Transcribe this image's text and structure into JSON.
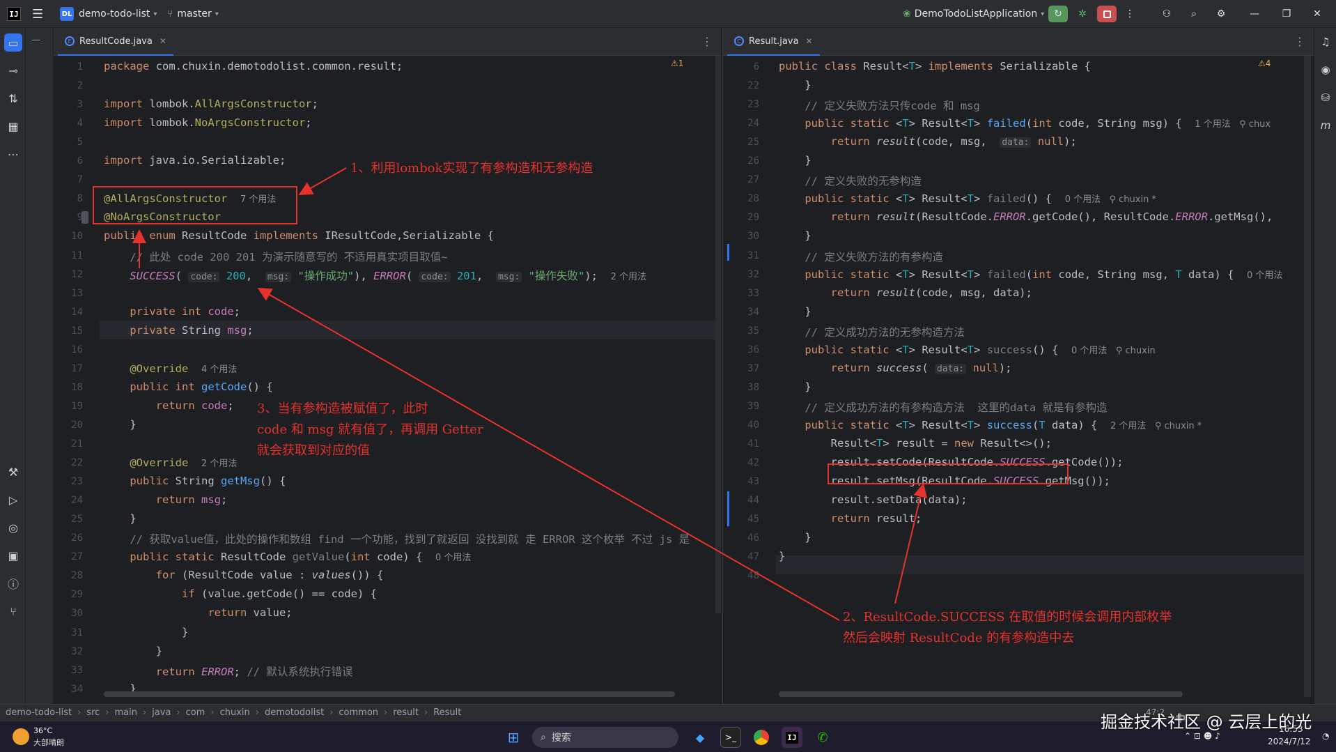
{
  "titlebar": {
    "app_logo": "IJ",
    "project_badge": "DL",
    "project_name": "demo-todo-list",
    "branch": "master",
    "run_config": "DemoTodoListApplication"
  },
  "left_editor": {
    "tab": "ResultCode.java",
    "warnings": "⚠1",
    "lines": [
      {
        "n": "1",
        "html": "<span class='kw'>package</span> com.chuxin.demotodolist.common.result;"
      },
      {
        "n": "2",
        "html": ""
      },
      {
        "n": "3",
        "html": "<span class='kw'>import</span> lombok.<span class='ann'>AllArgsConstructor</span>;"
      },
      {
        "n": "4",
        "html": "<span class='kw'>import</span> lombok.<span class='ann'>NoArgsConstructor</span>;"
      },
      {
        "n": "5",
        "html": ""
      },
      {
        "n": "6",
        "html": "<span class='kw'>import</span> java.io.Serializable;"
      },
      {
        "n": "7",
        "html": ""
      },
      {
        "n": "8",
        "html": "<span class='ann'>@AllArgsConstructor</span>  <span class='hint'>7 个用法</span>"
      },
      {
        "n": "9",
        "html": "<span class='ann'>@NoArgsConstructor</span>"
      },
      {
        "n": "10",
        "html": "<span class='kw'>public enum</span> ResultCode <span class='kw'>implements</span> IResultCode,Serializable {"
      },
      {
        "n": "11",
        "html": "    <span class='cm'>// 此处 code 200 201 为演示随意写的 不适用真实项目取值~</span>"
      },
      {
        "n": "12",
        "html": "    <span class='cst'>SUCCESS</span>( <span class='inlay'>code:</span> <span class='num'>200</span>,  <span class='inlay'>msg:</span> <span class='str'>\"操作成功\"</span>), <span class='cst'>ERROR</span>( <span class='inlay'>code:</span> <span class='num'>201</span>,  <span class='inlay'>msg:</span> <span class='str'>\"操作失败\"</span>);  <span class='hint'>2 个用法</span>"
      },
      {
        "n": "13",
        "html": ""
      },
      {
        "n": "14",
        "html": "    <span class='kw'>private int</span> <span class='cst' style='font-style:normal'>code</span>;"
      },
      {
        "n": "15",
        "html": "    <span class='kw'>private</span> String <span class='cst' style='font-style:normal'>msg</span>;"
      },
      {
        "n": "16",
        "html": ""
      },
      {
        "n": "17",
        "html": "    <span class='ann'>@Override</span>  <span class='hint'>4 个用法</span>"
      },
      {
        "n": "18",
        "html": "    <span class='kw'>public int</span> <span class='fn'>getCode</span>() {"
      },
      {
        "n": "19",
        "html": "        <span class='kw'>return</span> <span class='cst' style='font-style:normal'>code</span>;"
      },
      {
        "n": "20",
        "html": "    }"
      },
      {
        "n": "21",
        "html": ""
      },
      {
        "n": "22",
        "html": "    <span class='ann'>@Override</span>  <span class='hint'>2 个用法</span>"
      },
      {
        "n": "23",
        "html": "    <span class='kw'>public</span> String <span class='fn'>getMsg</span>() {"
      },
      {
        "n": "24",
        "html": "        <span class='kw'>return</span> <span class='cst' style='font-style:normal'>msg</span>;"
      },
      {
        "n": "25",
        "html": "    }"
      },
      {
        "n": "26",
        "html": "    <span class='cm'>// 获取value值，此处的操作和数组 find 一个功能，找到了就返回 没找到就 走 ERROR 这个枚举 不过 js 是</span>"
      },
      {
        "n": "27",
        "html": "    <span class='kw'>public static</span> ResultCode <span class='fn' style='color:#7a7e85'>getValue</span>(<span class='kw'>int</span> code) {  <span class='hint'>0 个用法</span>"
      },
      {
        "n": "28",
        "html": "        <span class='kw'>for</span> (ResultCode value : <span class='it'>values</span>()) {"
      },
      {
        "n": "29",
        "html": "            <span class='kw'>if</span> (value.getCode() == code) {"
      },
      {
        "n": "30",
        "html": "                <span class='kw'>return</span> value;"
      },
      {
        "n": "31",
        "html": "            }"
      },
      {
        "n": "32",
        "html": "        }"
      },
      {
        "n": "33",
        "html": "        <span class='kw'>return</span> <span class='cst'>ERROR</span>; <span class='cm'>// 默认系统执行错误</span>"
      },
      {
        "n": "34",
        "html": "    }"
      }
    ]
  },
  "right_editor": {
    "tab": "Result.java",
    "warnings": "⚠4",
    "lines": [
      {
        "n": "6",
        "html": "<span class='kw'>public class</span> Result&lt;<span class='num'>T</span>&gt; <span class='kw'>implements</span> Serializable {"
      },
      {
        "n": "22",
        "html": "    }"
      },
      {
        "n": "23",
        "html": "    <span class='cm'>// 定义失败方法只传code 和 msg</span>"
      },
      {
        "n": "24",
        "html": "    <span class='kw'>public static</span> &lt;<span class='num'>T</span>&gt; Result&lt;<span class='num'>T</span>&gt; <span class='fn'>failed</span>(<span class='kw'>int</span> code, String msg) {  <span class='hint'>1 个用法   ⚲ chux</span>"
      },
      {
        "n": "25",
        "html": "        <span class='kw'>return</span> <span class='it'>result</span>(code, msg,  <span class='inlay'>data:</span> <span class='kw'>null</span>);"
      },
      {
        "n": "26",
        "html": "    }"
      },
      {
        "n": "27",
        "html": "    <span class='cm'>// 定义失败的无参构造</span>"
      },
      {
        "n": "28",
        "html": "    <span class='kw'>public static</span> &lt;<span class='num'>T</span>&gt; Result&lt;<span class='num'>T</span>&gt; <span class='fn' style='color:#7a7e85'>failed</span>() {  <span class='hint'>0 个用法   ⚲ chuxin *</span>"
      },
      {
        "n": "29",
        "html": "        <span class='kw'>return</span> <span class='it'>result</span>(ResultCode.<span class='cst'>ERROR</span>.getCode(), ResultCode.<span class='cst'>ERROR</span>.getMsg(),"
      },
      {
        "n": "30",
        "html": "    }"
      },
      {
        "n": "31",
        "html": "    <span class='cm'>// 定义失败方法的有参构造</span>"
      },
      {
        "n": "32",
        "html": "    <span class='kw'>public static</span> &lt;<span class='num'>T</span>&gt; Result&lt;<span class='num'>T</span>&gt; <span class='fn' style='color:#7a7e85'>failed</span>(<span class='kw'>int</span> code, String msg, <span class='num'>T</span> data) {  <span class='hint'>0 个用法</span>"
      },
      {
        "n": "33",
        "html": "        <span class='kw'>return</span> <span class='it'>result</span>(code, msg, data);"
      },
      {
        "n": "34",
        "html": "    }"
      },
      {
        "n": "35",
        "html": "    <span class='cm'>// 定义成功方法的无参构造方法</span>"
      },
      {
        "n": "36",
        "html": "    <span class='kw'>public static</span> &lt;<span class='num'>T</span>&gt; Result&lt;<span class='num'>T</span>&gt; <span class='fn' style='color:#7a7e85'>success</span>() {  <span class='hint'>0 个用法   ⚲ chuxin</span>"
      },
      {
        "n": "37",
        "html": "        <span class='kw'>return</span> <span class='it'>success</span>( <span class='inlay'>data:</span> <span class='kw'>null</span>);"
      },
      {
        "n": "38",
        "html": "    }"
      },
      {
        "n": "39",
        "html": "    <span class='cm'>// 定义成功方法的有参构造方法  这里的data 就是有参构造</span>"
      },
      {
        "n": "40",
        "html": "    <span class='kw'>public static</span> &lt;<span class='num'>T</span>&gt; Result&lt;<span class='num'>T</span>&gt; <span class='fn'>success</span>(<span class='num'>T</span> data) {  <span class='hint'>2 个用法   ⚲ chuxin *</span>"
      },
      {
        "n": "41",
        "html": "        Result&lt;<span class='num'>T</span>&gt; result = <span class='kw'>new</span> Result&lt;&gt;();"
      },
      {
        "n": "42",
        "html": "        result.setCode(ResultCode.<span class='cst'>SUCCESS</span>.getCode());"
      },
      {
        "n": "43",
        "html": "        result.setMsg(ResultCode.<span class='cst'>SUCCESS</span>.getMsg());"
      },
      {
        "n": "44",
        "html": "        result.setData(data);"
      },
      {
        "n": "45",
        "html": "        <span class='kw'>return</span> result;"
      },
      {
        "n": "46",
        "html": "    }"
      },
      {
        "n": "47",
        "html": "}"
      },
      {
        "n": "48",
        "html": ""
      }
    ]
  },
  "notes": {
    "note1": "1、利用lombok实现了有参构造和无参构造",
    "note2_line1": "2、ResultCode.SUCCESS 在取值的时候会调用内部枚举",
    "note2_line2": "然后会映射 ResultCode 的有参构造中去",
    "note3_line1": "3、当有参构造被赋值了，此时",
    "note3_line2": "code 和 msg 就有值了，再调用 Getter",
    "note3_line3": "就会获取到对应的值"
  },
  "breadcrumb": [
    "demo-todo-list",
    "src",
    "main",
    "java",
    "com",
    "chuxin",
    "demotodolist",
    "common",
    "result",
    "Result"
  ],
  "status": {
    "position": "47:2"
  },
  "taskbar": {
    "weather_temp": "36°C",
    "weather_desc": "大部晴朗",
    "search_label": "搜索",
    "time": "16:53",
    "date": "2024/7/12",
    "ime": "中"
  },
  "watermark": "掘金技术社区 @ 云层上的光",
  "colors": {
    "accent": "#3574f0",
    "annotation_red": "#e5322d",
    "editor_bg": "#1e1f22",
    "chrome_bg": "#2b2d30"
  }
}
